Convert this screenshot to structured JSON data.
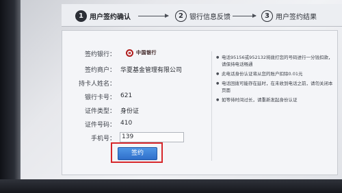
{
  "steps": [
    {
      "num": "1",
      "label": "用户签约确认"
    },
    {
      "num": "2",
      "label": "银行信息反馈"
    },
    {
      "num": "3",
      "label": "用户签约结果"
    }
  ],
  "form": {
    "bank_label": "签约银行：",
    "bank_logo_text": "中国银行",
    "merchant_label": "签约商户：",
    "merchant_value": "华夏基金管理有限公司",
    "holder_label": "持卡人姓名：",
    "card_label": "银行卡号：",
    "card_value": "621",
    "id_type_label": "证件类型：",
    "id_type_value": "身份证",
    "id_number_label": "证件号码：",
    "id_number_value": "410",
    "phone_label": "手机号：",
    "phone_value": "139"
  },
  "submit_label": "签约",
  "notes": [
    "电话95156或952132将拨打您的号码进行一分钱扣款，请保持电话畅通",
    "此电话身份认证将从您的账户扣除0.01元",
    "电话回拨可能存在延时，在未收到电话之前，请勿关闭本页面",
    "如等待时间过长，请重新发起身份认证"
  ],
  "colors": {
    "highlight_border": "#d6262a",
    "button": "#3a7fd6",
    "bank_red": "#b01a1a"
  }
}
